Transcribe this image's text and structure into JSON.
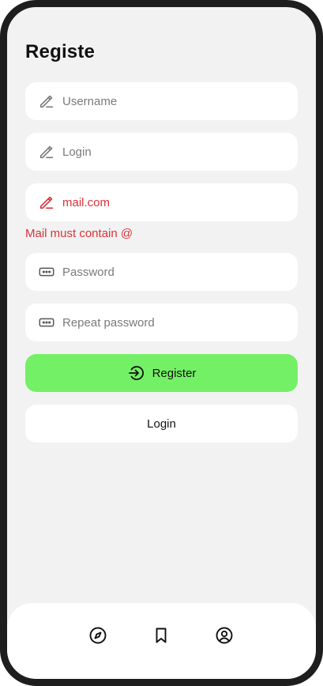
{
  "page": {
    "title": "Registe"
  },
  "form": {
    "username": {
      "placeholder": "Username",
      "value": "",
      "icon": "pencil-icon"
    },
    "login": {
      "placeholder": "Login",
      "value": "",
      "icon": "pencil-icon"
    },
    "email": {
      "placeholder": "",
      "value": "mail.com",
      "icon": "pencil-icon",
      "state": "error"
    },
    "email_error": "Mail must contain @",
    "password": {
      "placeholder": "Password",
      "value": "",
      "icon": "password-dots-icon"
    },
    "repeat_password": {
      "placeholder": "Repeat password",
      "value": "",
      "icon": "password-dots-icon"
    }
  },
  "buttons": {
    "register_label": "Register",
    "register_icon": "arrow-right-circle-icon",
    "login_label": "Login"
  },
  "bottom_nav": {
    "items": [
      {
        "icon": "compass-icon"
      },
      {
        "icon": "bookmark-icon"
      },
      {
        "icon": "user-circle-icon"
      }
    ]
  },
  "colors": {
    "background": "#f2f2f2",
    "surface": "#ffffff",
    "accent_green": "#74f066",
    "error_red": "#d9323a",
    "frame": "#1e1e1e",
    "text": "#111111",
    "placeholder": "#7a7a7a"
  }
}
